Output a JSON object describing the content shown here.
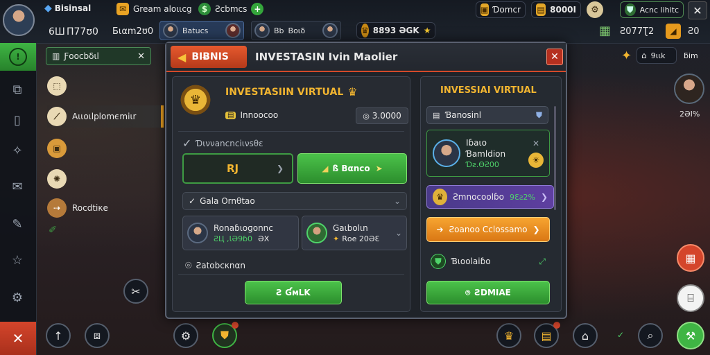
{
  "top": {
    "brand": "Bisinsal",
    "player_level": "6Ш",
    "player_stat": "Π77ʊ0",
    "player_balance": "Ƃιαm2ʊ0",
    "quest": "Gream aloιιcg",
    "cash": "Ƨcbmcs",
    "friend_1": "Batucs",
    "friend_1_count": "Bb",
    "friend_2": "Boιδ",
    "coins": "8893 ƏGK",
    "currency_1": "Ɗomcr",
    "currency_2": "8000I",
    "profile_btn": "Acnc lihitc",
    "right_value": "Ƨ077Ʈ2",
    "right_small": "Ƨ0",
    "online_label": "9ιιk",
    "online_label_2": "ƃim",
    "right_avatar_pct": "2ƏI%"
  },
  "left_panel": {
    "search_label": "Ƒoocbδιl",
    "items": [
      "Aιιoιlplomϵmiιr",
      "Rocdtiκe"
    ]
  },
  "modal": {
    "tab_label": "BIɃNIS",
    "title": "INVESTASIN Ivin Maolier",
    "main": {
      "heading": "INVESTASIIN VIRTUAL",
      "subtext": "Ιnnoocoo",
      "amount": "3.0000",
      "section_label": "Ɗιννancnciινsθε",
      "left_btn": "RJ",
      "right_btn": "ß Bαnco",
      "dropdown_label": "Gala Ornθtao",
      "person_1_name": "Ronaɓιoɡonnc",
      "person_1_value": "ƧЦ ,ƖƏ9ɓ0",
      "person_1_pct": "ƏX",
      "person_2_name": "Gaιbolιn",
      "person_2_value": "Rοe 20ƏƐ",
      "footer_label": "Ƨаtоbcκnαn",
      "confirm_btn": "Ƨ ƓᴍLK"
    },
    "side": {
      "heading": "INVESSIAI VIRTUAL",
      "search_value": "Ɓanosinl",
      "agent_name": "Iɓaιo",
      "agent_role": "Ɓamldiοn",
      "agent_value": "Ɗƨ.ƟƧ00",
      "rank_text": "Ƨmnocoolɓo",
      "rank_pct": "9Ɛƨ2%",
      "orange_btn": "Ƨoanoo Cclossamo",
      "shield_label": "Ɓιoolaiɓo",
      "bottom_btn": "ƧDMIAE"
    }
  },
  "colors": {
    "accent_red": "#d44a2a",
    "accent_green": "#3fb544",
    "accent_orange": "#f0921f",
    "gold": "#f2b530",
    "purple": "#5e3fa0"
  }
}
